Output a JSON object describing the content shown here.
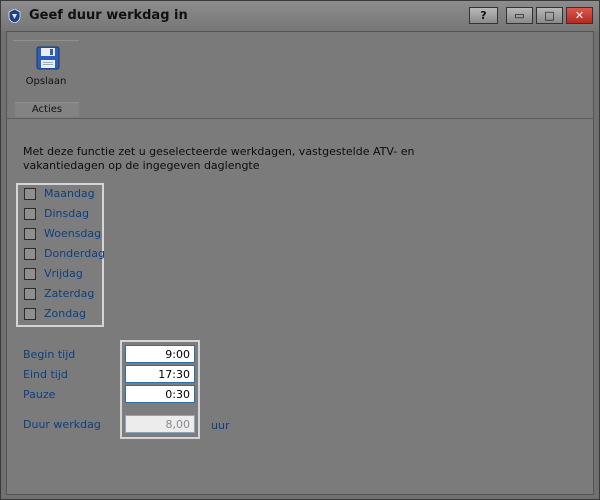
{
  "window": {
    "title": "Geef duur werkdag in",
    "buttons": {
      "help": "?",
      "minimize": "▭",
      "maximize": "□",
      "close": "✕"
    }
  },
  "ribbon": {
    "save_label": "Opslaan",
    "group_label": "Acties"
  },
  "description": "Met deze functie zet u geselecteerde werkdagen, vastgestelde ATV- en vakantiedagen op de ingegeven daglengte",
  "days": [
    {
      "label": "Maandag",
      "checked": false
    },
    {
      "label": "Dinsdag",
      "checked": false
    },
    {
      "label": "Woensdag",
      "checked": false
    },
    {
      "label": "Donderdag",
      "checked": false
    },
    {
      "label": "Vrijdag",
      "checked": false
    },
    {
      "label": "Zaterdag",
      "checked": false
    },
    {
      "label": "Zondag",
      "checked": false
    }
  ],
  "fields": {
    "begin_label": "Begin tijd",
    "begin_value": "9:00",
    "end_label": "Eind tijd",
    "end_value": "17:30",
    "pause_label": "Pauze",
    "pause_value": "0:30",
    "duration_label": "Duur werkdag",
    "duration_value": "8,00",
    "duration_unit": "uur"
  },
  "colors": {
    "accent": "#0f3f80",
    "background": "#7b7b7b",
    "close": "#c4372d"
  }
}
